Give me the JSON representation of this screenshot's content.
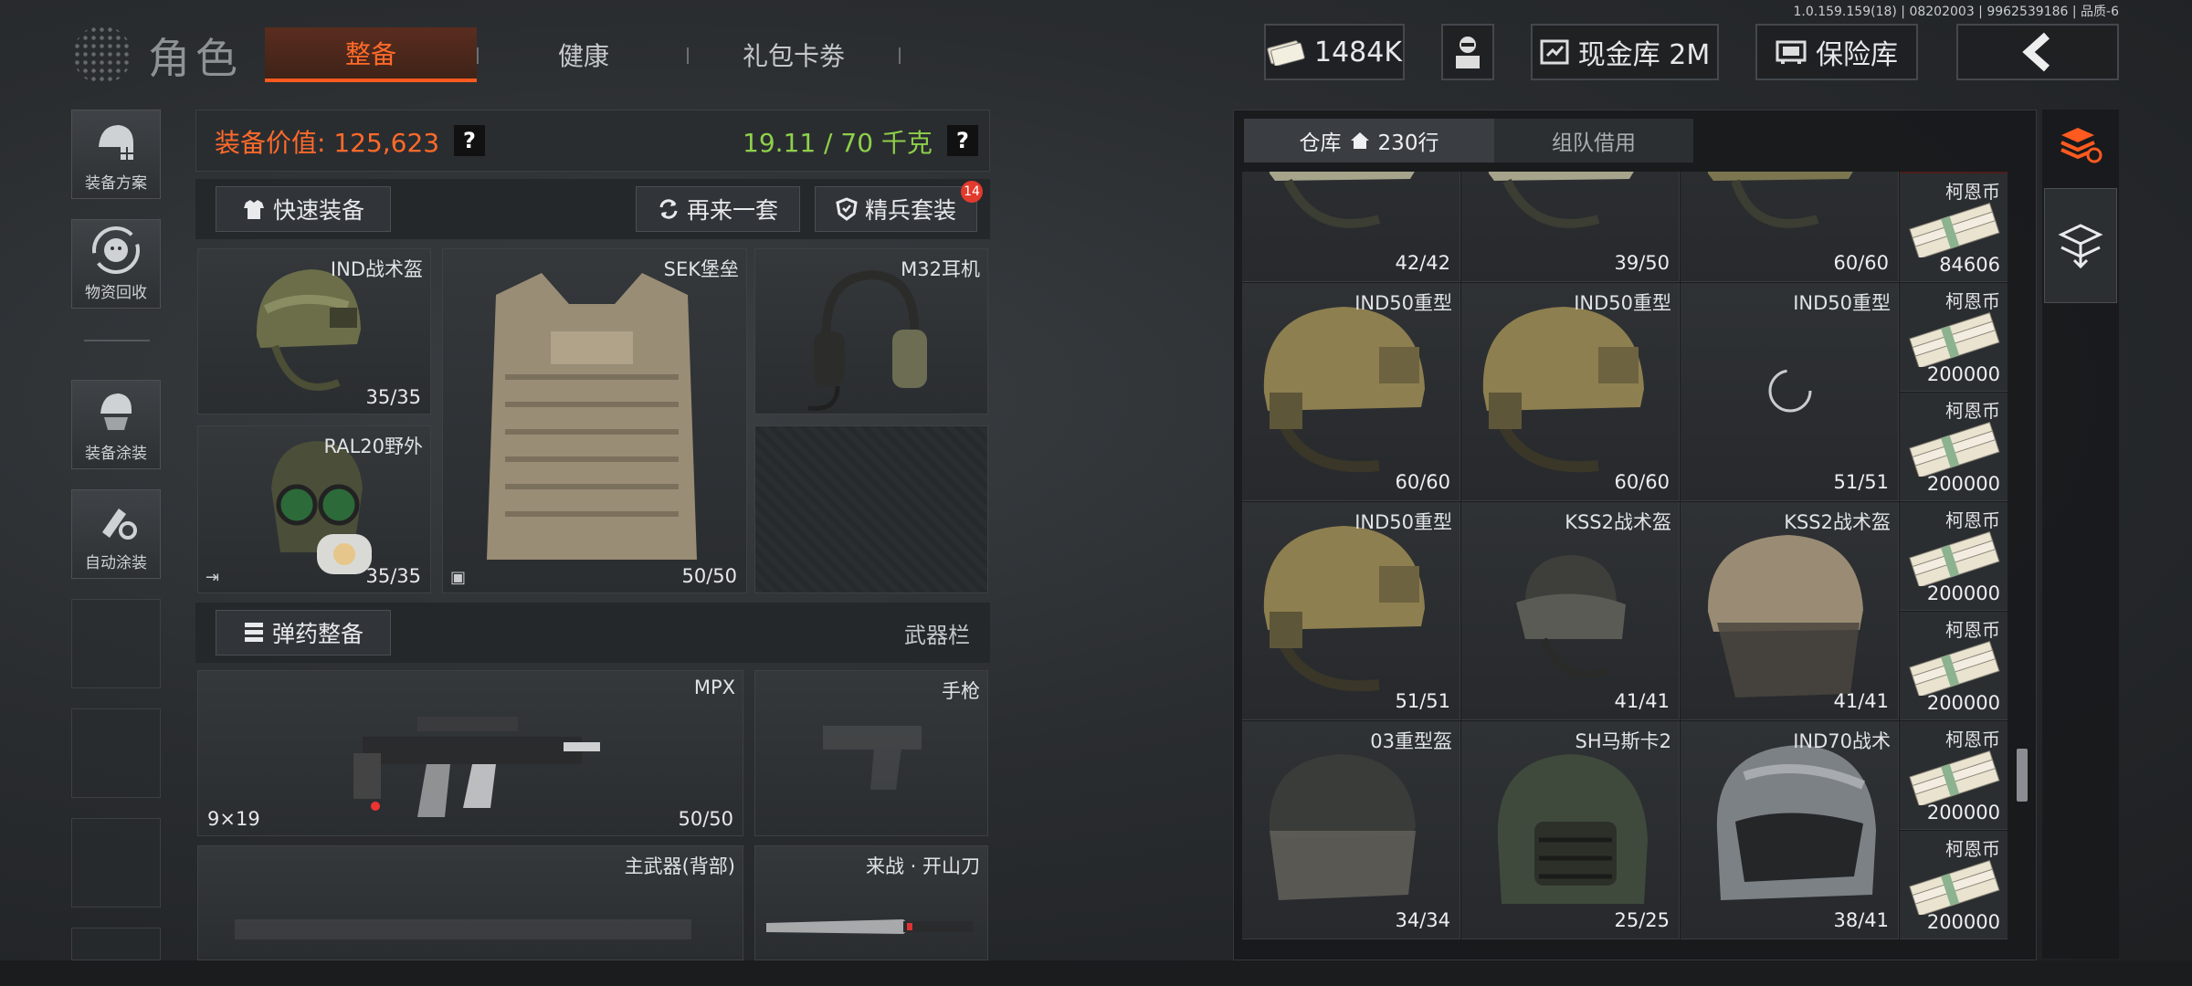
{
  "version": "1.0.159.159(18) | 08202003 | 9962539186 | 品质-6",
  "header": {
    "title": "角色",
    "tabs": [
      {
        "label": "整备",
        "active": true
      },
      {
        "label": "健康"
      },
      {
        "label": "礼包卡劵"
      }
    ],
    "currency": "1484K",
    "cash_vault": "现金库 2M",
    "insurance": "保险库"
  },
  "sidebar": [
    {
      "label": "装备方案",
      "icon": "gear-plan-icon"
    },
    {
      "label": "物资回收",
      "icon": "recycle-icon"
    },
    {
      "label": "装备涂装",
      "icon": "paint-icon"
    },
    {
      "label": "自动涂装",
      "icon": "auto-paint-icon"
    }
  ],
  "equipment": {
    "value_label": "装备价值: 125,623",
    "weight": "19.11 / 70 千克",
    "quick_equip": "快速装备",
    "again": "再来一套",
    "elite": "精兵套装",
    "elite_badge": "14",
    "slots": {
      "helmet": {
        "name": "IND战术盔",
        "dur": "35/35"
      },
      "armor": {
        "name": "SEK堡垒",
        "dur": "50/50"
      },
      "headset": {
        "name": "M32耳机"
      },
      "mask": {
        "name": "RAL20野外",
        "dur": "35/35"
      }
    },
    "ammo_btn": "弹药整备",
    "weapon_bar": "武器栏",
    "primary": {
      "name": "MPX",
      "dur": "50/50",
      "caliber": "9×19"
    },
    "pistol": {
      "name": "手枪"
    },
    "back": {
      "name": "主武器(背部)"
    },
    "melee": {
      "name": "来战 · 开山刀"
    }
  },
  "warehouse": {
    "tab_storage": "仓库",
    "rows": "230行",
    "tab_team": "组队借用",
    "cells": [
      {
        "name": "",
        "dur": "42/42",
        "type": "helmet-light"
      },
      {
        "name": "",
        "dur": "39/50",
        "type": "helmet-light"
      },
      {
        "name": "",
        "dur": "60/60",
        "type": "helmet-olive"
      },
      {
        "name": "IND50重型",
        "dur": "60/60",
        "type": "helmet-tan"
      },
      {
        "name": "IND50重型",
        "dur": "60/60",
        "type": "helmet-tan"
      },
      {
        "name": "IND50重型",
        "dur": "51/51",
        "type": "loading"
      },
      {
        "name": "IND50重型",
        "dur": "51/51",
        "type": "helmet-tan"
      },
      {
        "name": "KSS2战术盔",
        "dur": "41/41",
        "type": "helmet-cap"
      },
      {
        "name": "KSS2战术盔",
        "dur": "41/41",
        "type": "helmet-visor"
      },
      {
        "name": "03重型盔",
        "dur": "34/34",
        "type": "helmet-dark"
      },
      {
        "name": "SH马斯卡2",
        "dur": "25/25",
        "type": "helmet-mask"
      },
      {
        "name": "IND70战术",
        "dur": "38/41",
        "type": "helmet-grey"
      }
    ],
    "cash": [
      {
        "name": "柯恩币",
        "amt": "84606"
      },
      {
        "name": "柯恩币",
        "amt": "200000"
      },
      {
        "name": "柯恩币",
        "amt": "200000"
      },
      {
        "name": "柯恩币",
        "amt": "200000"
      },
      {
        "name": "柯恩币",
        "amt": "200000"
      },
      {
        "name": "柯恩币",
        "amt": "200000"
      },
      {
        "name": "柯恩币",
        "amt": "200000"
      }
    ]
  }
}
